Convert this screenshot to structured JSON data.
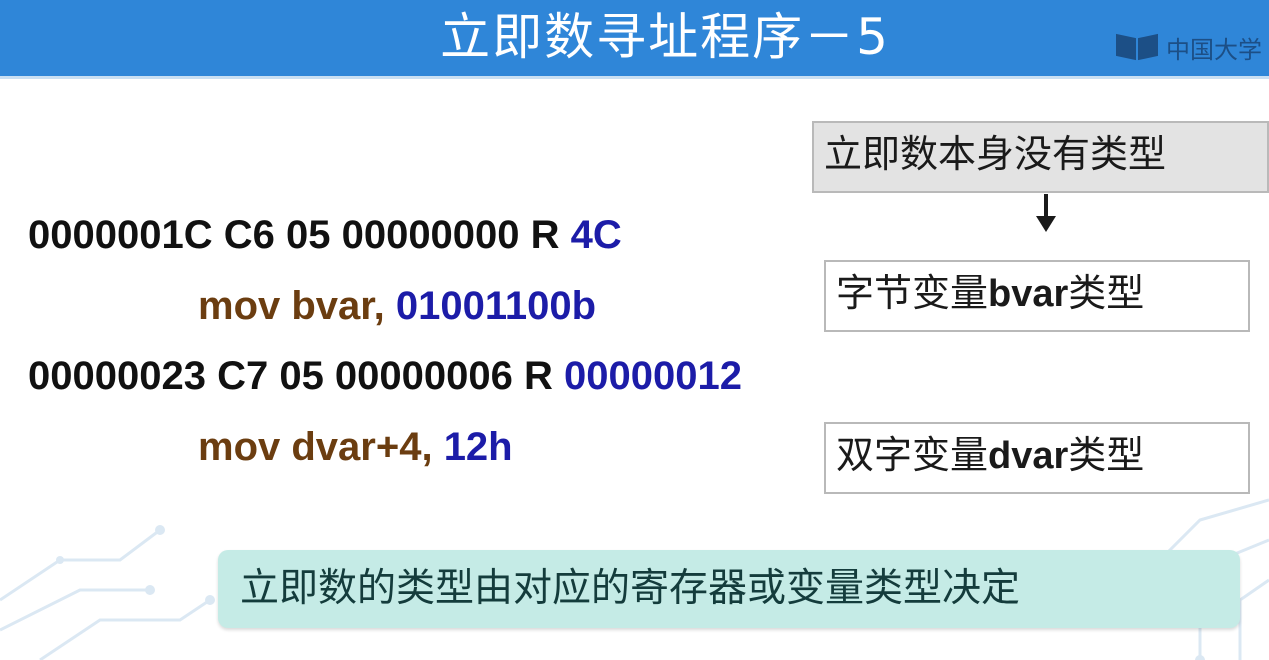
{
  "slide": {
    "title": "立即数寻址程序－5",
    "logo_text": "中国大学"
  },
  "code": {
    "line1": {
      "addr": "0000001C C6 05 00000000 R ",
      "imm": "4C"
    },
    "line2": {
      "instr": "mov bvar, ",
      "imm": "01001100b"
    },
    "line3": {
      "addr": "00000023 C7 05 00000006 R ",
      "imm": "00000012"
    },
    "line4": {
      "instr": "mov dvar+4, ",
      "imm": "12h"
    }
  },
  "notes": {
    "top": "立即数本身没有类型",
    "byte_prefix": "字节变量",
    "byte_var": "bvar",
    "byte_suffix": "类型",
    "dword_prefix": "双字变量",
    "dword_var": "dvar",
    "dword_suffix": "类型"
  },
  "summary": "立即数的类型由对应的寄存器或变量类型决定",
  "colors": {
    "header": "#2f86d8",
    "address_text": "#111111",
    "instruction_text": "#6b3d10",
    "immediate_text": "#1c1ca8",
    "summary_bg": "#c5ebe6"
  }
}
